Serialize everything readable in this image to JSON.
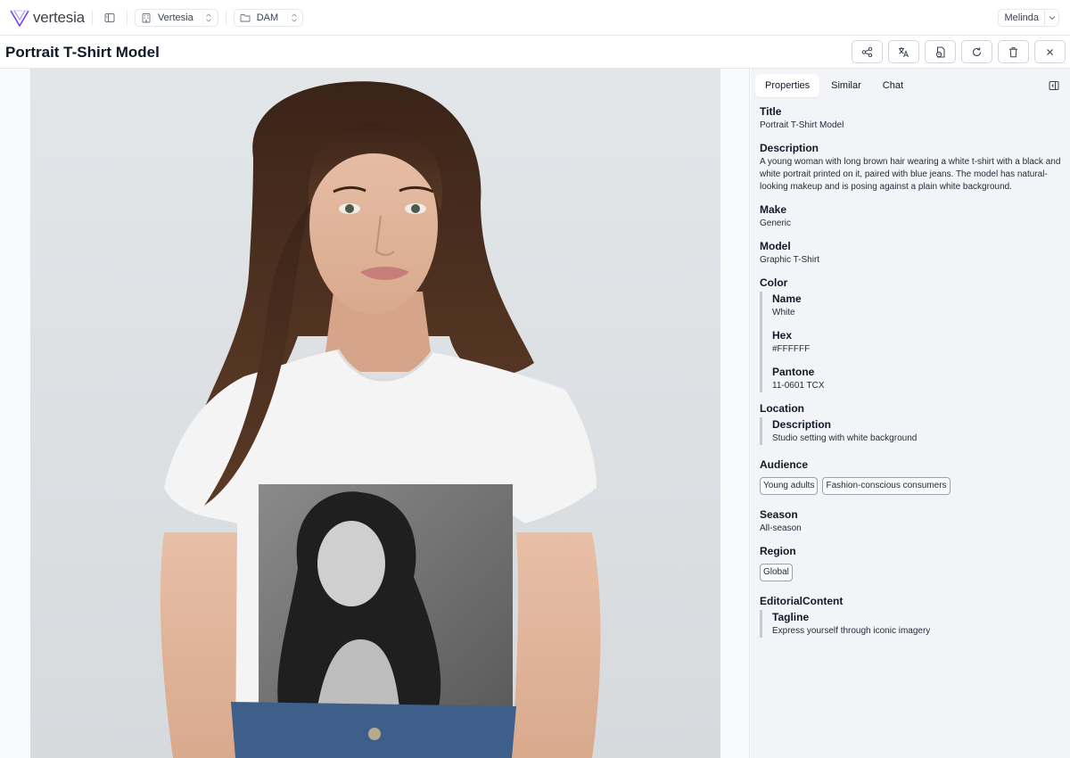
{
  "app": {
    "logo_text": "vertesia",
    "accent": "#7c3aed"
  },
  "nav": {
    "workspace": "Vertesia",
    "project": "DAM",
    "user": "Melinda"
  },
  "header": {
    "title": "Portrait T-Shirt Model",
    "actions": [
      "share-icon",
      "translate-icon",
      "file-refresh-icon",
      "refresh-icon",
      "trash-icon",
      "close-icon"
    ]
  },
  "panel": {
    "tabs": [
      "Properties",
      "Similar",
      "Chat"
    ],
    "active_tab": "Properties",
    "properties": {
      "title": {
        "label": "Title",
        "value": "Portrait T-Shirt Model"
      },
      "description": {
        "label": "Description",
        "value": "A young woman with long brown hair wearing a white t-shirt with a black and white portrait printed on it, paired with blue jeans. The model has natural-looking makeup and is posing against a plain white background."
      },
      "make": {
        "label": "Make",
        "value": "Generic"
      },
      "model": {
        "label": "Model",
        "value": "Graphic T-Shirt"
      },
      "color": {
        "label": "Color",
        "name": {
          "label": "Name",
          "value": "White"
        },
        "hex": {
          "label": "Hex",
          "value": "#FFFFFF"
        },
        "pantone": {
          "label": "Pantone",
          "value": "11-0601 TCX"
        }
      },
      "location": {
        "label": "Location",
        "description": {
          "label": "Description",
          "value": "Studio setting with white background"
        }
      },
      "audience": {
        "label": "Audience",
        "tags": [
          "Young adults",
          "Fashion-conscious consumers"
        ]
      },
      "season": {
        "label": "Season",
        "value": "All-season"
      },
      "region": {
        "label": "Region",
        "tags": [
          "Global"
        ]
      },
      "editorial": {
        "label": "EditorialContent",
        "tagline": {
          "label": "Tagline",
          "value": "Express yourself through iconic imagery"
        }
      }
    }
  }
}
